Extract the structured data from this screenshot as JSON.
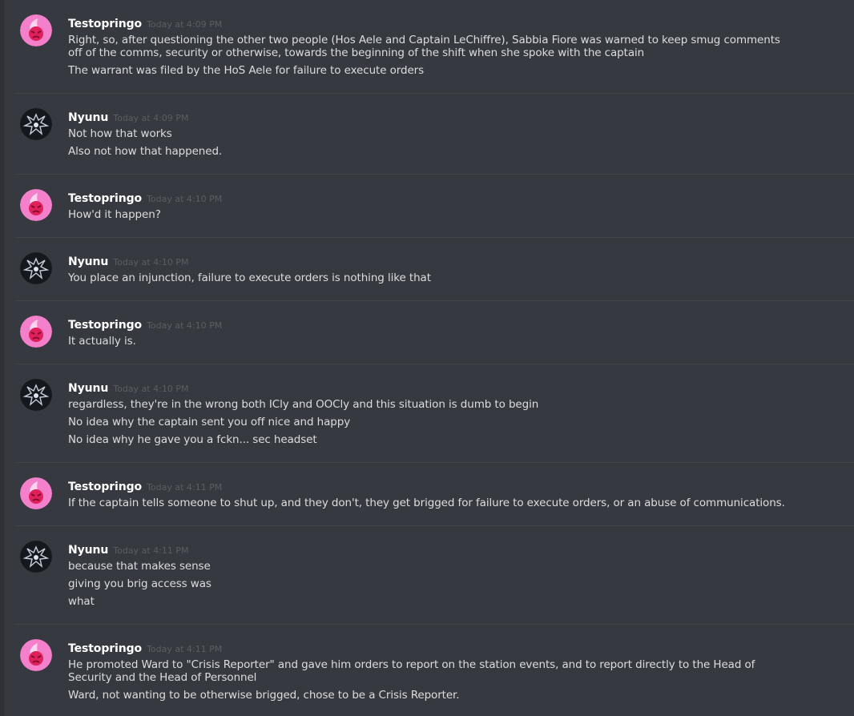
{
  "messages": [
    {
      "author": "Testopringo",
      "timestamp": "Today at 4:09 PM",
      "avatar": "pink-avatar",
      "lines": [
        "Right, so, after questioning the other two people (Hos Aele and Captain LeChiffre), Sabbia Fiore was warned to keep smug comments off of the comms, security or otherwise, towards the beginning of the shift when she spoke with the captain",
        "The warrant was filed by the HoS Aele for failure to execute orders"
      ]
    },
    {
      "author": "Nyunu",
      "timestamp": "Today at 4:09 PM",
      "avatar": "dark-avatar",
      "lines": [
        "Not how that works",
        "Also not how that happened."
      ]
    },
    {
      "author": "Testopringo",
      "timestamp": "Today at 4:10 PM",
      "avatar": "pink-avatar",
      "lines": [
        "How'd it happen?"
      ]
    },
    {
      "author": "Nyunu",
      "timestamp": "Today at 4:10 PM",
      "avatar": "dark-avatar",
      "lines": [
        "You place an injunction, failure to execute orders is nothing like that"
      ]
    },
    {
      "author": "Testopringo",
      "timestamp": "Today at 4:10 PM",
      "avatar": "pink-avatar",
      "lines": [
        "It actually is."
      ]
    },
    {
      "author": "Nyunu",
      "timestamp": "Today at 4:10 PM",
      "avatar": "dark-avatar",
      "lines": [
        "regardless, they're in the wrong both ICly and OOCly and this situation is dumb to begin",
        "No idea why the captain sent you off nice and happy",
        "No idea why he gave you a fckn... sec headset"
      ]
    },
    {
      "author": "Testopringo",
      "timestamp": "Today at 4:11 PM",
      "avatar": "pink-avatar",
      "lines": [
        "If the captain tells someone to shut up, and they don't, they get brigged for failure to execute orders, or an abuse of communications."
      ]
    },
    {
      "author": "Nyunu",
      "timestamp": "Today at 4:11 PM",
      "avatar": "dark-avatar",
      "lines": [
        "because that makes sense",
        "giving you brig access was",
        "what"
      ]
    },
    {
      "author": "Testopringo",
      "timestamp": "Today at 4:11 PM",
      "avatar": "pink-avatar",
      "lines": [
        "He promoted Ward to \"Crisis Reporter\" and gave him orders to report on the station events, and to report directly to the Head of Security and the Head of Personnel",
        "Ward, not wanting to be otherwise brigged, chose to be a Crisis Reporter."
      ]
    }
  ],
  "colors": {
    "background": "#36393f",
    "username": "#ffffff",
    "timestamp": "#5b5e63",
    "text": "#dcddde",
    "pink_avatar": "#f47fcb"
  }
}
